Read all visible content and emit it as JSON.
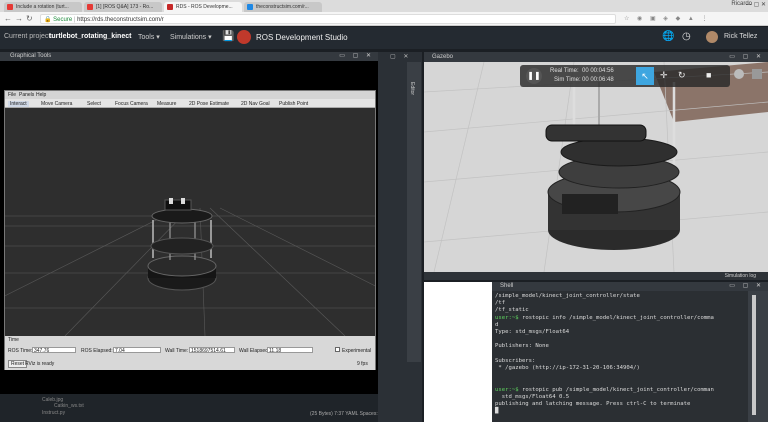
{
  "browser": {
    "tabs": [
      {
        "label": "Include a rotation (turt...",
        "color": "#e53935"
      },
      {
        "label": "[1] [ROS Q&A] 173 - Ro...",
        "color": "#e53935"
      },
      {
        "label": "RDS - ROS Developme...",
        "color": "#c62828"
      },
      {
        "label": "theconstructsim.com/r...",
        "color": "#1e88e5"
      }
    ],
    "user": "Ricardo",
    "secure_label": "Secure",
    "url": "https://rds.theconstructsim.com/r"
  },
  "app": {
    "project_label": "Current project:",
    "project_name": "turtlebot_rotating_kinect",
    "menu_tools": "Tools",
    "menu_simulations": "Simulations",
    "title": "ROS Development Studio",
    "user_name": "Rick Tellez"
  },
  "left_panel": {
    "title": "Graphical Tools",
    "rviz": {
      "menu": [
        "File",
        "Panels",
        "Help"
      ],
      "tools": [
        "Interact",
        "Move Camera",
        "Select",
        "Focus Camera",
        "Measure",
        "2D Pose Estimate",
        "2D Nav Goal",
        "Publish Point"
      ],
      "time_label": "Time",
      "ros_time_label": "ROS Time:",
      "ros_time": "347.76",
      "ros_elapsed_label": "ROS Elapsed:",
      "ros_elapsed": "7.04",
      "wall_time_label": "Wall Time:",
      "wall_time": "1518697514.61",
      "wall_elapsed_label": "Wall Elapsed:",
      "wall_elapsed": "11.18",
      "experimental_label": "Experimental",
      "reset_label": "Reset",
      "status": "RViz is ready",
      "fps": "9 fps"
    },
    "file_items": [
      "Caleb.jpg",
      "Catkin_ws.txt",
      "Instruct.py"
    ],
    "status_bar": "(25 Bytes)   7:37   YAML   Spaces: 4"
  },
  "middle": {
    "vertical_tab": "Editor"
  },
  "gazebo": {
    "title": "Gazebo",
    "real_time_label": "Real Time:",
    "real_time": "00 00:04:56",
    "sim_time_label": "Sim Time:",
    "sim_time": "00 00:06:48",
    "footer": "Simulation log"
  },
  "shell": {
    "title": "Shell",
    "lines": [
      {
        "text": "/simple_model/kinect_joint_controller/state",
        "prompt": false
      },
      {
        "text": "/tf",
        "prompt": false
      },
      {
        "text": "/tf_static",
        "prompt": false
      },
      {
        "text": "user:~$ rostopic info /simple_model/kinect_joint_controller/comma",
        "prompt": true
      },
      {
        "text": "d",
        "prompt": false
      },
      {
        "text": "Type: std_msgs/Float64",
        "prompt": false
      },
      {
        "text": "",
        "prompt": false
      },
      {
        "text": "Publishers: None",
        "prompt": false
      },
      {
        "text": "",
        "prompt": false
      },
      {
        "text": "Subscribers:",
        "prompt": false
      },
      {
        "text": " * /gazebo (http://ip-172-31-20-106:34904/)",
        "prompt": false
      },
      {
        "text": "",
        "prompt": false
      },
      {
        "text": "",
        "prompt": false
      },
      {
        "text": "user:~$ rostopic pub /simple_model/kinect_joint_controller/comman",
        "prompt": true
      },
      {
        "text": "  std_msgs/Float64 0.5",
        "prompt": false
      },
      {
        "text": "publishing and latching message. Press ctrl-C to terminate",
        "prompt": false
      },
      {
        "text": "█",
        "prompt": false
      }
    ]
  }
}
